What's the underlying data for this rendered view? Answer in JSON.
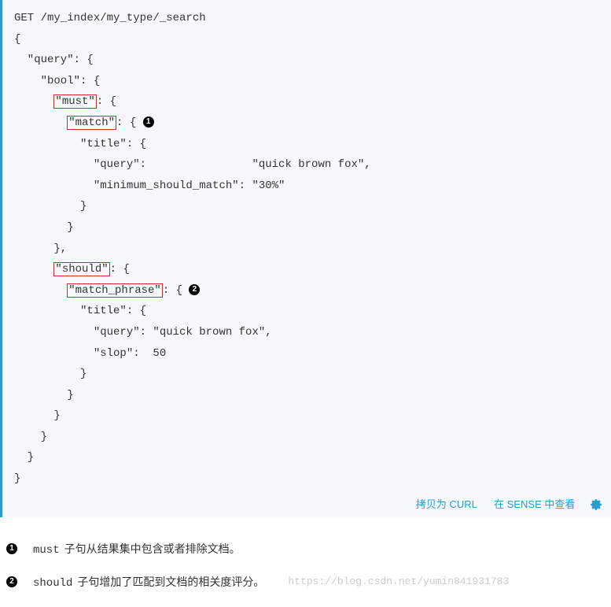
{
  "code": {
    "line1": "GET /my_index/my_type/_search",
    "line2": "{",
    "line3": "  \"query\": {",
    "line4": "    \"bool\": {",
    "line5_a": "      ",
    "line5_hl": "\"must\"",
    "line5_b": ": {",
    "line6_a": "        ",
    "line6_hl": "\"match\"",
    "line6_b": ": { ",
    "line7": "          \"title\": {",
    "line8": "            \"query\":                \"quick brown fox\",",
    "line9": "            \"minimum_should_match\": \"30%\"",
    "line10": "          }",
    "line11": "        }",
    "line12": "      },",
    "line13_a": "      ",
    "line13_hl": "\"should\"",
    "line13_b": ": {",
    "line14_a": "        ",
    "line14_hl": "\"match_phrase\"",
    "line14_b": ": { ",
    "line15": "          \"title\": {",
    "line16": "            \"query\": \"quick brown fox\",",
    "line17": "            \"slop\":  50",
    "line18": "          }",
    "line19": "        }",
    "line20": "      }",
    "line21": "    }",
    "line22": "  }",
    "line23": "}"
  },
  "callout_nums": {
    "one": "1",
    "two": "2"
  },
  "toolbar": {
    "copy_curl": "拷贝为 CURL",
    "view_sense": "在 SENSE 中查看"
  },
  "list": {
    "item1_code": "must",
    "item1_text": "子句从结果集中包含或者排除文档。",
    "item2_code": "should",
    "item2_text": "子句增加了匹配到文档的相关度评分。"
  },
  "watermark": "https://blog.csdn.net/yumin841931783"
}
